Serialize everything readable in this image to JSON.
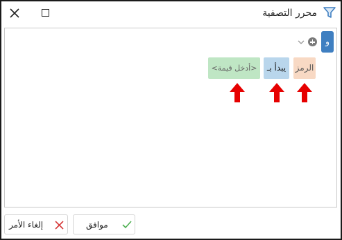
{
  "window": {
    "title": "محرر التصفية"
  },
  "editor": {
    "group_operator": "و",
    "condition": {
      "field": "الرمز",
      "operator": "يبدأ بـ",
      "value_placeholder": "<أدخل قيمة>"
    }
  },
  "buttons": {
    "ok": "موافق",
    "cancel": "إلغاء الأمر"
  },
  "colors": {
    "accent": "#3f7fc1",
    "field_chip": "#f8d9c4",
    "operator_chip": "#b9d6ec",
    "value_chip": "#bfe6c4",
    "annotation_arrow": "#e60000"
  },
  "icons": {
    "title": "filter-icon",
    "close": "close-icon",
    "maximize": "maximize-icon",
    "add": "add-circle-icon",
    "dropdown": "chevron-down-icon",
    "ok": "checkmark-icon",
    "cancel": "x-icon"
  }
}
